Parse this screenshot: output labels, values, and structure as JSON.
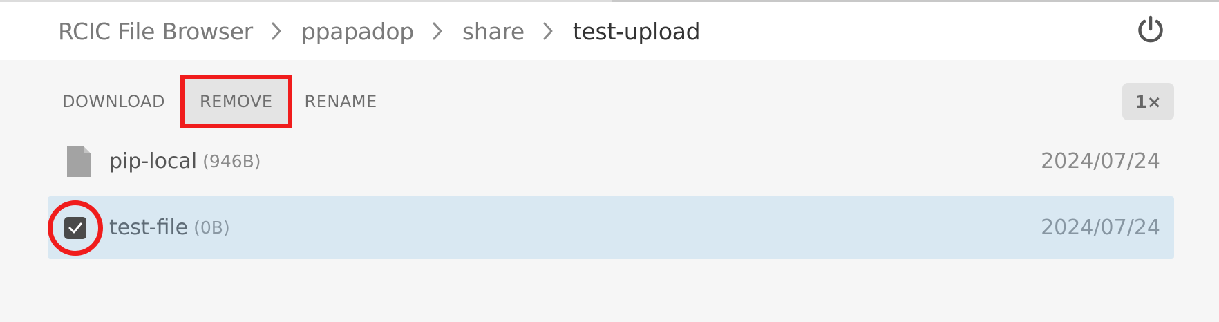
{
  "header": {
    "breadcrumb": [
      {
        "label": "RCIC File Browser"
      },
      {
        "label": "ppapadop"
      },
      {
        "label": "share"
      },
      {
        "label": "test-upload"
      }
    ],
    "power_icon": "power-icon"
  },
  "toolbar": {
    "download_label": "DOWNLOAD",
    "remove_label": "REMOVE",
    "rename_label": "RENAME",
    "speed_label": "1×"
  },
  "files": [
    {
      "name": "pip-local",
      "size": "(946B)",
      "date": "2024/07/24",
      "icon": "file-icon",
      "selected": false
    },
    {
      "name": "test-file",
      "size": "(0B)",
      "date": "2024/07/24",
      "icon": "checkbox-checked-icon",
      "selected": true
    }
  ],
  "colors": {
    "accent_highlight": "#f01c1c",
    "selected_row_bg": "#d9e8f2",
    "background": "#f6f6f6"
  }
}
